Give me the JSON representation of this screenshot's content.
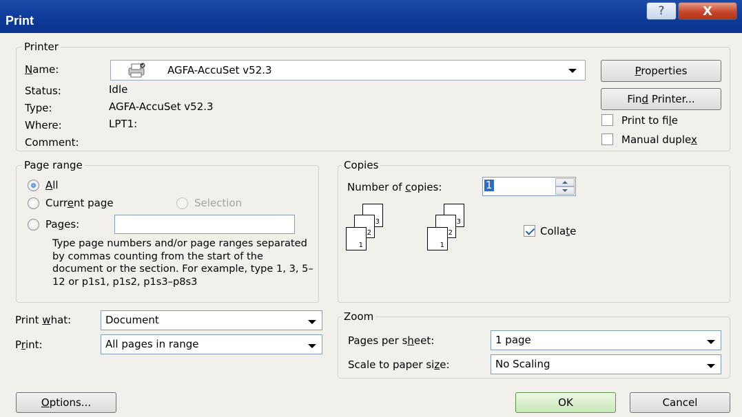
{
  "window": {
    "title": "Print",
    "help_glyph": "?",
    "close_glyph": "X"
  },
  "printer": {
    "legend": "Printer",
    "name_label_key": "N",
    "name_label_rest": "ame:",
    "name_value": "AGFA-AccuSet v52.3",
    "status_label": "Status:",
    "status_value": "Idle",
    "type_label": "Type:",
    "type_value": "AGFA-AccuSet v52.3",
    "where_label": "Where:",
    "where_value": "LPT1:",
    "comment_label": "Comment:",
    "comment_value": "",
    "properties_key": "P",
    "properties_rest": "roperties",
    "find_pre": "Fin",
    "find_key": "d",
    "find_post": " Printer...",
    "print_to_file_pre": "Print to fi",
    "print_to_file_key": "l",
    "print_to_file_post": "e",
    "print_to_file_checked": false,
    "manual_duplex_pre": "Manual duple",
    "manual_duplex_key": "x",
    "manual_duplex_checked": false
  },
  "page_range": {
    "legend": "Page range",
    "all_key": "A",
    "all_rest": "ll",
    "current_pre": "Curr",
    "current_key": "e",
    "current_post": "nt page",
    "selection": "Selection",
    "pages_pre": "Pa",
    "pages_key": "g",
    "pages_post": "es:",
    "pages_value": "",
    "selected": "all",
    "help_text": "Type page numbers and/or page ranges separated by commas counting from the start of the document or the section. For example, type 1, 3, 5–12 or p1s1, p1s2, p1s3–p8s3"
  },
  "copies": {
    "legend": "Copies",
    "number_pre": "Number of ",
    "number_key": "c",
    "number_post": "opies:",
    "number_value": "1",
    "sheet_numbers": [
      "3",
      "2",
      "1"
    ],
    "collate_pre": "Colla",
    "collate_key": "t",
    "collate_post": "e",
    "collate_checked": true
  },
  "print_what": {
    "label_pre": "Print ",
    "label_key": "w",
    "label_post": "hat:",
    "value": "Document"
  },
  "print": {
    "label_pre": "P",
    "label_key": "r",
    "label_post": "int:",
    "value": "All pages in range"
  },
  "zoom": {
    "legend": "Zoom",
    "pages_per_sheet_pre": "Pages per s",
    "pages_per_sheet_key": "h",
    "pages_per_sheet_post": "eet:",
    "pages_per_sheet_value": "1 page",
    "scale_pre": "Scale to paper si",
    "scale_key": "z",
    "scale_post": "e:",
    "scale_value": "No Scaling"
  },
  "footer": {
    "options_key": "O",
    "options_rest": "ptions...",
    "ok": "OK",
    "cancel": "Cancel"
  },
  "colors": {
    "titlebar": "#0c3a98",
    "dialog_bg": "#f1f0ea",
    "close_button": "#c7462b",
    "selection": "#316ac5"
  },
  "icons": {
    "printer": "printer-icon",
    "dropdown": "chevron-down-icon"
  }
}
